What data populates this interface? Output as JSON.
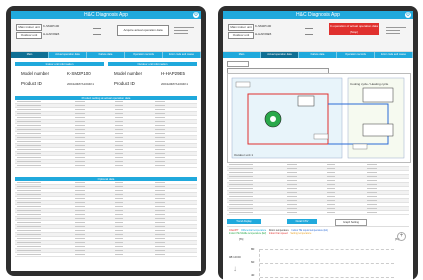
{
  "left": {
    "title": "H&C Diagnosis App",
    "main_indoor_unit_label": "Main indoor unit",
    "main_indoor_unit_value": "K-SM2P100",
    "outdoor_unit_label": "Outdoor unit",
    "outdoor_unit_value": "H-HAP29E5",
    "acquire_button": "Acquire actual operation data",
    "tabs": [
      "Main",
      "Actual operation data",
      "Failure data",
      "Operation records",
      "Error code and cause"
    ],
    "section_indoor": "Indoor unit information",
    "section_outdoor": "Outdoor unit information",
    "model_number_label": "Model number",
    "model_number_indoor": "K-SM2P100",
    "model_number_outdoor": "H-HAP29E5",
    "product_id_label": "Product ID",
    "product_id_indoor": "2004H0M7A1004K1",
    "product_id_outdoor": "2004H0M7A1004K1",
    "table1_title": "Product setting at actual operation data",
    "table2_title": "Optional data"
  },
  "right": {
    "title": "H&C Diagnosis App",
    "main_indoor_unit_label": "Main indoor unit",
    "main_indoor_unit_value": "K-SM2P100",
    "outdoor_unit_label": "Outdoor unit",
    "outdoor_unit_value": "H-HAP29E5",
    "acquire_button": "In operation of actual operation data (Stop)",
    "tabs": [
      "Main",
      "Actual operation data",
      "Failure data",
      "Operation records",
      "Error code and cause"
    ],
    "diagram_caption_left": "Outdoor unit 1",
    "diagram_caption_right": "Cooling cycle / Heating cycle",
    "legend_items": [
      "Chart/PT",
      "Differential temperature",
      "Room temperature",
      "Indoor HE Liquid temperature (E1)",
      "Indoor HE Middle temperature (E2)",
      "Indoor Fan speed",
      "Setting temperature"
    ],
    "y_axis_label": "[%]",
    "y_ticks": [
      "80",
      "60",
      "40"
    ],
    "y_label_right": "[%]",
    "time_label": "08:10:00",
    "chart_button_a": "Trend display",
    "chart_button_b": "Detail CSV",
    "chart_button_c": "Graph Setting"
  },
  "colors": {
    "accent": "#20a9dc",
    "red": "#e0302e",
    "tab_active": "#0f6f94"
  }
}
